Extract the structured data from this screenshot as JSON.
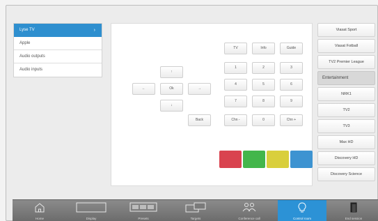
{
  "sidebar": {
    "items": [
      {
        "label": "Lyse TV",
        "active": true
      },
      {
        "label": "Apple"
      },
      {
        "label": "Audio outputs"
      },
      {
        "label": "Audio inputs"
      }
    ]
  },
  "remote": {
    "keys": {
      "tv": "TV",
      "info": "Info",
      "guide": "Guide",
      "up": "↑",
      "left": "←",
      "ok": "Ok",
      "right": "→",
      "down": "↓",
      "n1": "1",
      "n2": "2",
      "n3": "3",
      "n4": "4",
      "n5": "5",
      "n6": "6",
      "n7": "7",
      "n8": "8",
      "n9": "9",
      "back": "Back",
      "chn_minus": "Chn -",
      "n0": "0",
      "chn_plus": "Chn +"
    },
    "color_keys": [
      "#d9434f",
      "#43b64b",
      "#d9cf3c",
      "#3d93d1"
    ]
  },
  "channels": {
    "items": [
      {
        "label": "Viasat Sport"
      },
      {
        "label": "Viasat Fotball"
      },
      {
        "label": "TV2 Premier League"
      },
      {
        "label": "Entertainment",
        "header": true
      },
      {
        "label": "NRK1"
      },
      {
        "label": "TV2"
      },
      {
        "label": "TV3"
      },
      {
        "label": "Max HD"
      },
      {
        "label": "Discovery HD"
      },
      {
        "label": "Discovery Science"
      }
    ]
  },
  "bottom_nav": {
    "items": [
      {
        "label": "Home",
        "icon": "home-icon"
      },
      {
        "label": "Display",
        "icon": "display-icon"
      },
      {
        "label": "Presets",
        "icon": "presets-icon"
      },
      {
        "label": "Targets",
        "icon": "targets-icon"
      },
      {
        "label": "Conference call",
        "icon": "conference-icon"
      },
      {
        "label": "Control room",
        "icon": "lightbulb-icon",
        "active": true
      },
      {
        "label": "End session",
        "icon": "end-session-icon"
      }
    ]
  },
  "colors": {
    "accent": "#2e8fcf",
    "nav_bg": "#7a7a7a"
  }
}
